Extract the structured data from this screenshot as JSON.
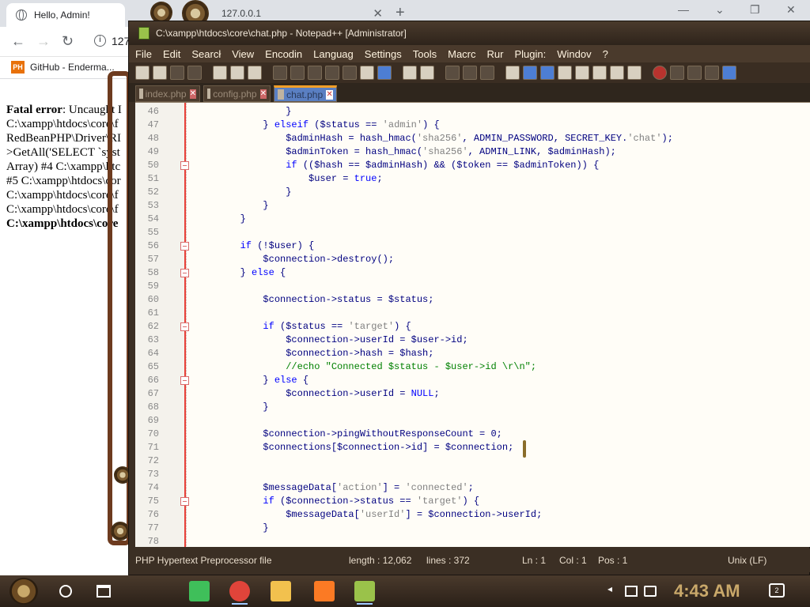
{
  "browser": {
    "tab_title": "Hello, Admin!",
    "tab2_title": "127.0.0.1",
    "address": "127",
    "bookmark": {
      "icon_text": "PH",
      "label": "GitHub - Enderma..."
    },
    "content_lines": [
      {
        "bold": "Fatal error",
        "rest": ": Uncaught I"
      },
      {
        "bold": "",
        "rest": "C:\\xampp\\htdocs\\core\\f"
      },
      {
        "bold": "",
        "rest": "RedBeanPHP\\Driver\\RI"
      },
      {
        "bold": "",
        "rest": ">GetAll('SELECT `syst"
      },
      {
        "bold": "",
        "rest": "Array) #4 C:\\xampp\\htc"
      },
      {
        "bold": "",
        "rest": "#5 C:\\xampp\\htdocs\\cor"
      },
      {
        "bold": "",
        "rest": "C:\\xampp\\htdocs\\core\\f"
      },
      {
        "bold": "",
        "rest": "C:\\xampp\\htdocs\\core\\f"
      },
      {
        "bold": "C:\\xampp\\htdocs\\core",
        "rest": ""
      }
    ]
  },
  "npp": {
    "title": "C:\\xampp\\htdocs\\core\\chat.php - Notepad++ [Administrator]",
    "menu": [
      "File",
      "Edit",
      "Searcł",
      "View",
      "Encodin",
      "Languag",
      "Settings",
      "Tools",
      "Macrc",
      "Rur",
      "Plugin:",
      "Windov",
      "?"
    ],
    "tabs": [
      {
        "label": "index.php",
        "active": false
      },
      {
        "label": "config.php",
        "active": false
      },
      {
        "label": "chat.php",
        "active": true
      }
    ],
    "code": [
      {
        "n": "46",
        "fold": false,
        "t": "                }"
      },
      {
        "n": "47",
        "fold": false,
        "t": "            } elseif ($status == 'admin') {"
      },
      {
        "n": "48",
        "fold": false,
        "t": "                $adminHash = hash_hmac('sha256', ADMIN_PASSWORD, SECRET_KEY.'chat');"
      },
      {
        "n": "49",
        "fold": false,
        "t": "                $adminToken = hash_hmac('sha256', ADMIN_LINK, $adminHash);"
      },
      {
        "n": "50",
        "fold": true,
        "t": "                if (($hash == $adminHash) && ($token == $adminToken)) {"
      },
      {
        "n": "51",
        "fold": false,
        "t": "                    $user = true;"
      },
      {
        "n": "52",
        "fold": false,
        "t": "                }"
      },
      {
        "n": "53",
        "fold": false,
        "t": "            }"
      },
      {
        "n": "54",
        "fold": false,
        "t": "        }"
      },
      {
        "n": "55",
        "fold": false,
        "t": ""
      },
      {
        "n": "56",
        "fold": true,
        "t": "        if (!$user) {"
      },
      {
        "n": "57",
        "fold": false,
        "t": "            $connection->destroy();"
      },
      {
        "n": "58",
        "fold": true,
        "t": "        } else {"
      },
      {
        "n": "59",
        "fold": false,
        "t": ""
      },
      {
        "n": "60",
        "fold": false,
        "t": "            $connection->status = $status;"
      },
      {
        "n": "61",
        "fold": false,
        "t": ""
      },
      {
        "n": "62",
        "fold": true,
        "t": "            if ($status == 'target') {"
      },
      {
        "n": "63",
        "fold": false,
        "t": "                $connection->userId = $user->id;"
      },
      {
        "n": "64",
        "fold": false,
        "t": "                $connection->hash = $hash;"
      },
      {
        "n": "65",
        "fold": false,
        "t": "                //echo \"Connected $status - $user->id \\r\\n\";"
      },
      {
        "n": "66",
        "fold": true,
        "t": "            } else {"
      },
      {
        "n": "67",
        "fold": false,
        "t": "                $connection->userId = NULL;"
      },
      {
        "n": "68",
        "fold": false,
        "t": "            }"
      },
      {
        "n": "69",
        "fold": false,
        "t": ""
      },
      {
        "n": "70",
        "fold": false,
        "t": "            $connection->pingWithoutResponseCount = 0;"
      },
      {
        "n": "71",
        "fold": false,
        "t": "            $connections[$connection->id] = $connection;"
      },
      {
        "n": "72",
        "fold": false,
        "t": ""
      },
      {
        "n": "73",
        "fold": false,
        "t": ""
      },
      {
        "n": "74",
        "fold": false,
        "t": "            $messageData['action'] = 'connected';"
      },
      {
        "n": "75",
        "fold": true,
        "t": "            if ($connection->status == 'target') {"
      },
      {
        "n": "76",
        "fold": false,
        "t": "                $messageData['userId'] = $connection->userId;"
      },
      {
        "n": "77",
        "fold": false,
        "t": "            }"
      },
      {
        "n": "78",
        "fold": false,
        "t": ""
      }
    ],
    "status": {
      "file_type": "PHP Hypertext Preprocessor file",
      "length": "length : 12,062",
      "lines": "lines : 372",
      "ln": "Ln : 1",
      "col": "Col : 1",
      "pos": "Pos : 1",
      "eol": "Unix (LF)"
    }
  },
  "taskbar": {
    "clock": "4:43 AM",
    "notification_count": "2",
    "apps": [
      {
        "name": "green-app-icon",
        "color": "#3fbf5a",
        "active": false
      },
      {
        "name": "chrome-icon",
        "color": "#e0443a",
        "active": true
      },
      {
        "name": "file-explorer-icon",
        "color": "#f2c14e",
        "active": false
      },
      {
        "name": "xampp-icon",
        "color": "#fb7a24",
        "active": false
      },
      {
        "name": "notepadpp-icon",
        "color": "#9ac24a",
        "active": true
      }
    ]
  },
  "colors": {
    "code_text": "#000080",
    "keyword": "#0000ff",
    "string": "#808080",
    "comment": "#008000",
    "active_tab_accent": "#f59f28",
    "clock": "#c9a86a"
  }
}
